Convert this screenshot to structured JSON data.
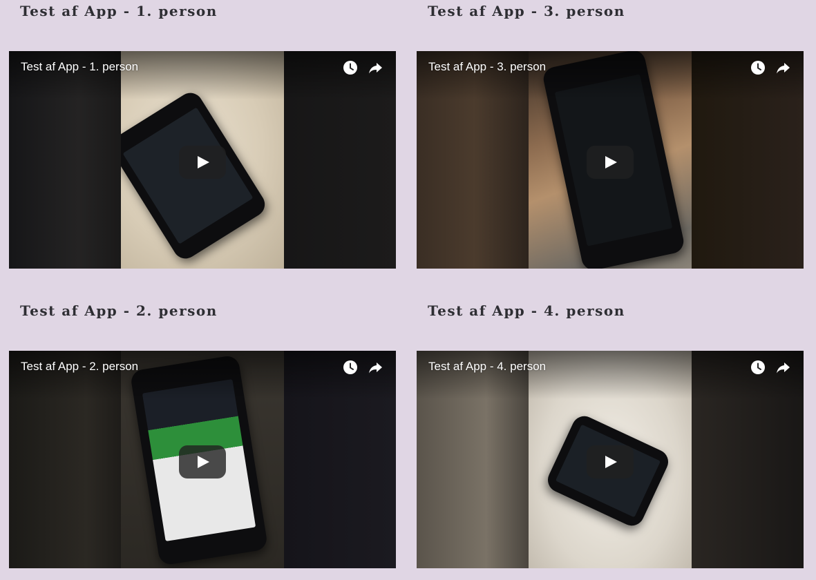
{
  "videos": [
    {
      "section_title": "Test af App - 1. person",
      "video_title": "Test af App - 1. person",
      "watch_later_icon": "clock-icon",
      "share_icon": "share-arrow-icon",
      "play_icon": "play-icon"
    },
    {
      "section_title": "Test af App - 3. person",
      "video_title": "Test af App - 3. person",
      "watch_later_icon": "clock-icon",
      "share_icon": "share-arrow-icon",
      "play_icon": "play-icon"
    },
    {
      "section_title": "Test af App - 2. person",
      "video_title": "Test af App - 2. person",
      "watch_later_icon": "clock-icon",
      "share_icon": "share-arrow-icon",
      "play_icon": "play-icon"
    },
    {
      "section_title": "Test af App - 4. person",
      "video_title": "Test af App - 4. person",
      "watch_later_icon": "clock-icon",
      "share_icon": "share-arrow-icon",
      "play_icon": "play-icon"
    }
  ],
  "colors": {
    "page_background": "#e0d6e4",
    "heading_text": "#2e2e33",
    "overlay_text": "#ffffff",
    "play_button": "#212121"
  }
}
